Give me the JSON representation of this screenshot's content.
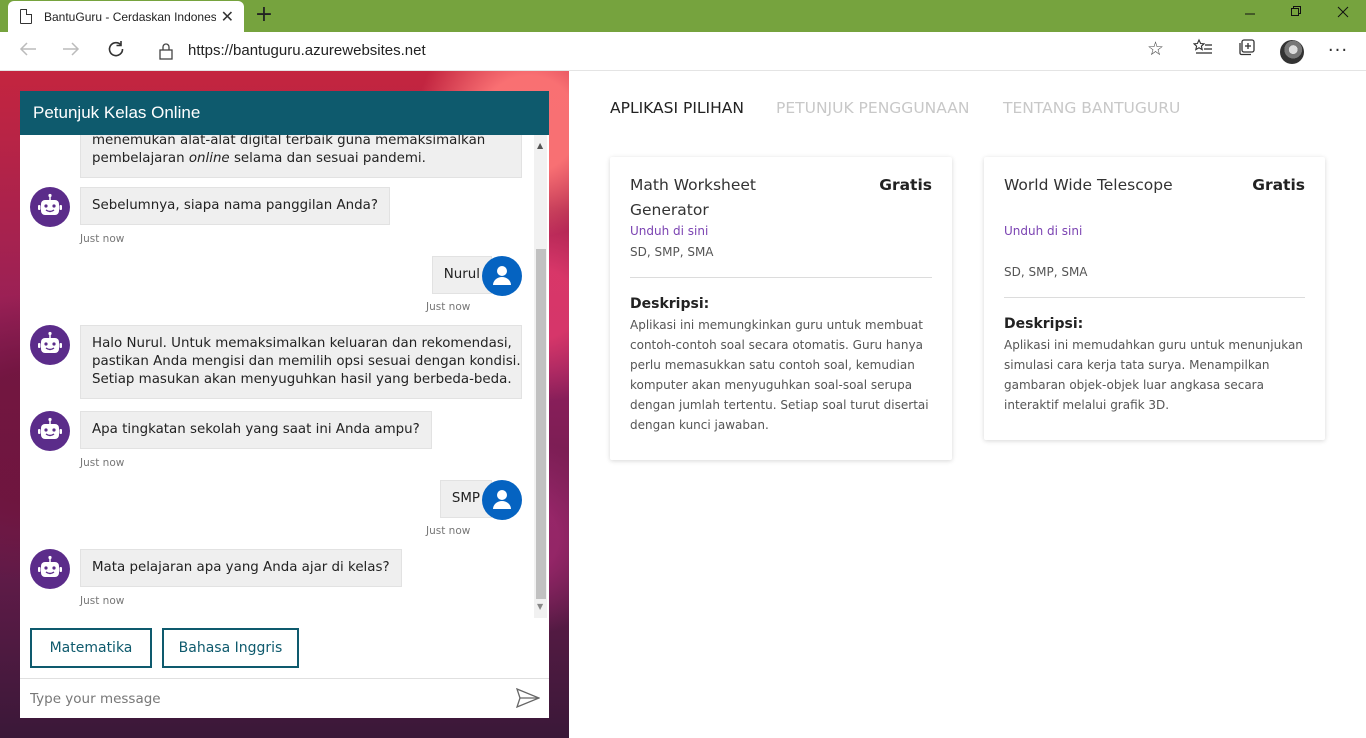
{
  "browser": {
    "tab_title": "BantuGuru - Cerdaskan Indonesia",
    "tab_close": "✕",
    "new_tab": "+",
    "url": "https://bantuguru.azurewebsites.net"
  },
  "chat": {
    "header": "Petunjuk Kelas Online",
    "messages": [
      {
        "from": "bot",
        "text_line1": "menemukan alat-alat digital terbaik guna memaksimalkan",
        "text_line2_pre": "pembelajaran ",
        "text_line2_em": "online",
        "text_line2_post": " selama dan sesuai pandemi."
      },
      {
        "from": "bot",
        "text": "Sebelumnya, siapa nama panggilan Anda?",
        "time": "Just now"
      },
      {
        "from": "user",
        "text": "Nurul",
        "time": "Just now"
      },
      {
        "from": "bot",
        "lines": [
          "Halo Nurul. Untuk memaksimalkan keluaran dan rekomendasi,",
          "pastikan Anda mengisi dan memilih opsi sesuai dengan kondisi.",
          "Setiap masukan akan menyuguhkan hasil yang berbeda-beda."
        ]
      },
      {
        "from": "bot",
        "text": "Apa tingkatan sekolah yang saat ini Anda ampu?",
        "time": "Just now"
      },
      {
        "from": "user",
        "text": "SMP",
        "time": "Just now"
      },
      {
        "from": "bot",
        "text": "Mata pelajaran apa yang Anda ajar di kelas?",
        "time": "Just now"
      }
    ],
    "suggested_actions": [
      "Matematika",
      "Bahasa Inggris"
    ],
    "input_placeholder": "Type your message"
  },
  "nav": {
    "tabs": [
      {
        "label": "APLIKASI PILIHAN",
        "active": true
      },
      {
        "label": "PETUNJUK PENGGUNAAN",
        "active": false
      },
      {
        "label": "TENTANG BANTUGURU",
        "active": false
      }
    ]
  },
  "apps": [
    {
      "title": "Math Worksheet Generator",
      "price": "Gratis",
      "link": "Unduh di sini",
      "levels": "SD, SMP, SMA",
      "desc_label": "Deskripsi:",
      "desc_lines": [
        "Aplikasi ini memungkinkan guru untuk membuat",
        "contoh-contoh soal secara otomatis. Guru hanya",
        "perlu memasukkan satu contoh soal, kemudian",
        "komputer akan menyuguhkan soal-soal serupa",
        "dengan jumlah tertentu. Setiap soal turut disertai",
        "dengan kunci jawaban."
      ]
    },
    {
      "title": "World Wide Telescope",
      "price": "Gratis",
      "link": "Unduh di sini",
      "levels": "SD, SMP, SMA",
      "desc_label": "Deskripsi:",
      "desc_lines": [
        "Aplikasi ini memudahkan guru untuk menunjukan",
        "simulasi cara kerja tata surya. Menampilkan",
        "gambaran objek-objek luar angkasa secara",
        "interaktif melalui grafik 3D."
      ]
    }
  ],
  "colors": {
    "titlebar": "#76a33e",
    "chat_header": "#0e5a6d",
    "bot_avatar": "#5b2c8a",
    "user_avatar": "#0563c1",
    "link": "#7b43b2"
  }
}
